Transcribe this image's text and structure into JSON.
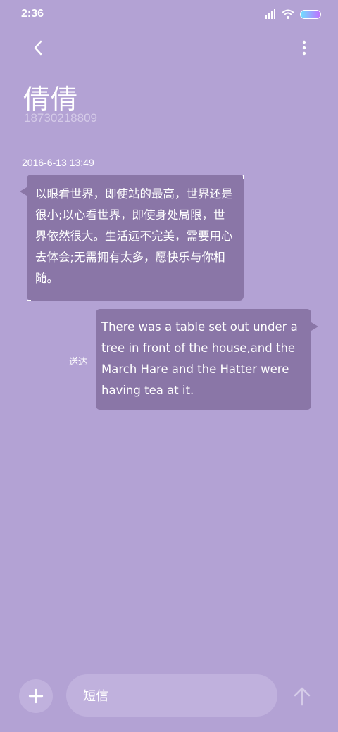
{
  "status_bar": {
    "time": "2:36",
    "battery_color": "#6ee0ff"
  },
  "header": {
    "back_icon": "chevron-left-icon",
    "more_icon": "more-vertical-icon",
    "contact_name": "倩倩",
    "contact_number": "18730218809"
  },
  "conversation": {
    "timestamp": "2016-6-13 13:49",
    "messages": [
      {
        "direction": "incoming",
        "text": "以眼看世界，即使站的最高，世界还是很小;以心看世界，即使身处局限，世界依然很大。生活远不完美，需要用心去体会;无需拥有太多，愿快乐与你相随。"
      },
      {
        "direction": "outgoing",
        "text": "There was a table set out under a tree in front of the house,and the March Hare and the Hatter were having tea at it.",
        "status": "送达"
      }
    ]
  },
  "composer": {
    "add_icon": "plus-icon",
    "placeholder": "短信",
    "send_icon": "arrow-up-icon"
  },
  "colors": {
    "background": "#b3a2d4",
    "bubble": "#8a76a7",
    "input": "#c0b1dd"
  }
}
